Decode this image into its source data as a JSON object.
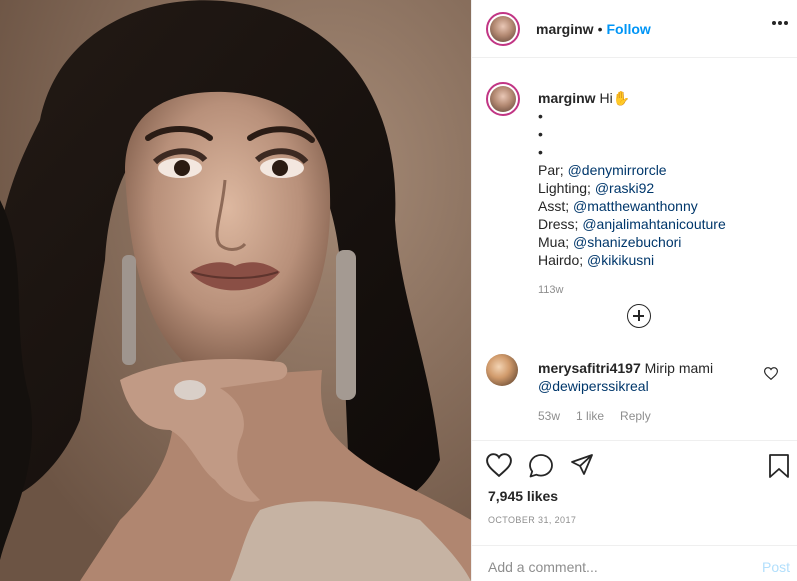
{
  "post": {
    "photo_alt": "",
    "author": {
      "username": "marginw",
      "follow_label": "Follow",
      "separator": "•"
    },
    "caption": {
      "username": "marginw",
      "lines": [
        "Hi✋",
        "•",
        "•",
        "•"
      ],
      "credits": [
        {
          "label": "Par; ",
          "mention": "@denymirrorcle"
        },
        {
          "label": "Lighting; ",
          "mention": "@raski92"
        },
        {
          "label": "Asst; ",
          "mention": "@matthewanthonny"
        },
        {
          "label": "Dress; ",
          "mention": "@anjalimahtanicouture"
        },
        {
          "label": "Mua; ",
          "mention": "@shanizebuchori"
        },
        {
          "label": "Hairdo; ",
          "mention": "@kikikusni"
        }
      ],
      "time": "113w"
    },
    "comment": {
      "username": "merysafitri4197",
      "text": "Mirip mami",
      "mention": "@dewiperssikreal",
      "time": "53w",
      "likes": "1 like",
      "reply_label": "Reply"
    },
    "likes": "7,945 likes",
    "date": "OCTOBER 31, 2017",
    "add_comment_placeholder": "Add a comment...",
    "post_label": "Post"
  },
  "icons": {
    "like": "heart-icon",
    "comment": "comment-icon",
    "share": "share-icon",
    "save": "bookmark-icon",
    "more": "more-options-icon",
    "load_more": "plus-circle-icon",
    "comment_like": "small-heart-icon"
  },
  "colors": {
    "accent": "#0095f6",
    "mention": "#00376b",
    "muted": "#8e8e8e",
    "story_ring": "#c13584"
  }
}
